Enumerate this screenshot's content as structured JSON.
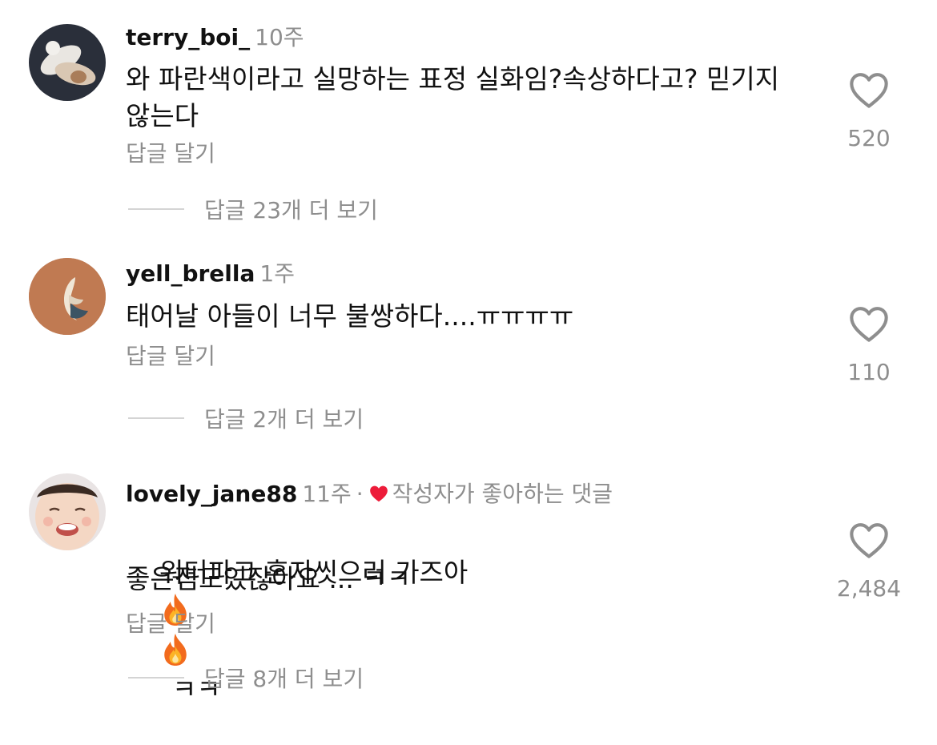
{
  "comments": [
    {
      "username": "terry_boi_",
      "time": "10주",
      "text": "와 파란색이라고 실망하는 표정 실화임?속상하다고? 믿기지\n않는다",
      "reply_label": "답글 달기",
      "likes": "520",
      "view_replies": "답글 23개 더 보기"
    },
    {
      "username": "yell_brella",
      "time": "1주",
      "text": "태어날 아들이 너무 불쌍하다....ㅠㅠㅠㅠ",
      "reply_label": "답글 달기",
      "likes": "110",
      "view_replies": "답글 2개 더 보기"
    },
    {
      "username": "lovely_jane88",
      "time": "11주",
      "separator": "·",
      "creator_liked": "작성자가 좋아하는 댓글",
      "text_line1": "워터파크 혼자씻으러 가즈아",
      "text_line1_tail": "ㅋㅋ",
      "text_line2": "좋은점도있잖아요 ... ㅋㅋ",
      "reply_label": "답글 달기",
      "likes": "2,484",
      "view_replies": "답글 8개 더 보기"
    }
  ],
  "icons": {
    "like": "heart-outline-icon",
    "creator_heart": "heart-filled-icon",
    "emoji": "fire-emoji"
  },
  "colors": {
    "creator_heart": "#ed1c3a",
    "secondary_text": "#8e8e8e"
  }
}
